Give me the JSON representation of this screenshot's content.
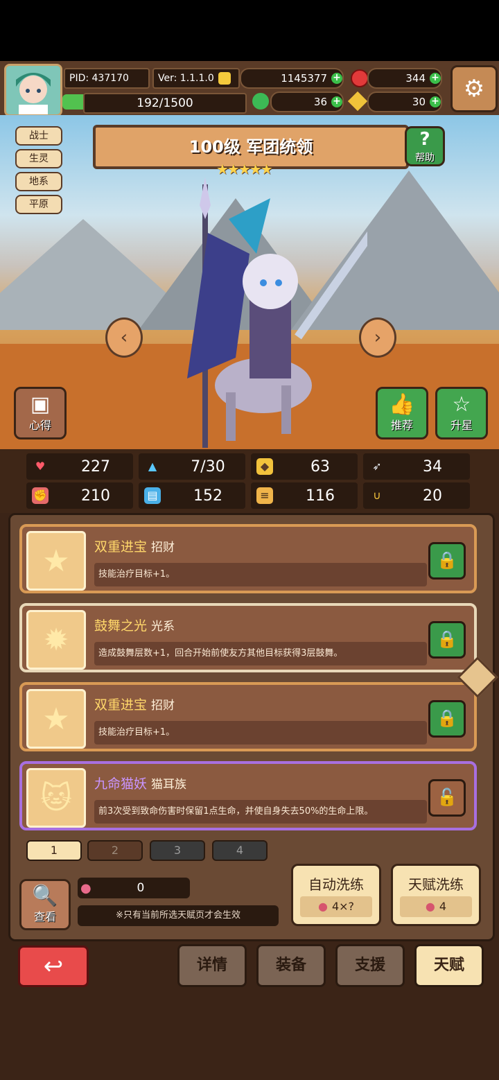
{
  "top": {
    "pid": "PID: 437170",
    "version": "Ver: 1.1.1.0",
    "gold": "1145377",
    "gem": "344",
    "exp": "192/1500",
    "clover": "36",
    "key": "30"
  },
  "hero": {
    "tags": [
      "战士",
      "生灵",
      "地系",
      "平原"
    ],
    "title": "100级 军团统领",
    "stars": "★★★★★",
    "help_label": "帮助",
    "xinde_label": "心得",
    "recommend_label": "推荐",
    "upgrade_label": "升星"
  },
  "stats": [
    {
      "icon": "heart-icon",
      "value": "227"
    },
    {
      "icon": "water-drop-icon",
      "value": "7/30"
    },
    {
      "icon": "shield-icon",
      "value": "63"
    },
    {
      "icon": "wing-icon",
      "value": "34"
    },
    {
      "icon": "fist-icon",
      "value": "210"
    },
    {
      "icon": "book-icon",
      "value": "152"
    },
    {
      "icon": "armor-icon",
      "value": "116"
    },
    {
      "icon": "horseshoe-icon",
      "value": "20"
    }
  ],
  "talents": [
    {
      "name": "双重进宝",
      "type": "招财",
      "desc": "技能治疗目标+1。",
      "locked": true
    },
    {
      "name": "鼓舞之光",
      "type": "光系",
      "desc": "造成鼓舞层数+1，回合开始前使友方其他目标获得3层鼓舞。",
      "locked": true
    },
    {
      "name": "双重进宝",
      "type": "招财",
      "desc": "技能治疗目标+1。",
      "locked": true
    },
    {
      "name": "九命猫妖",
      "type": "猫耳族",
      "desc": "前3次受到致命伤害时保留1点生命，并使自身失去50%的生命上限。",
      "locked": false
    }
  ],
  "pages": [
    "1",
    "2",
    "3",
    "4"
  ],
  "bottom": {
    "view_label": "查看",
    "fruit_count": "0",
    "notice": "※只有当前所选天赋页才会生效",
    "auto_refine": "自动洗练",
    "auto_cost": "4×?",
    "talent_refine": "天赋洗练",
    "talent_cost": "4"
  },
  "nav": {
    "details": "详情",
    "equip": "装备",
    "support": "支援",
    "talent": "天赋"
  }
}
